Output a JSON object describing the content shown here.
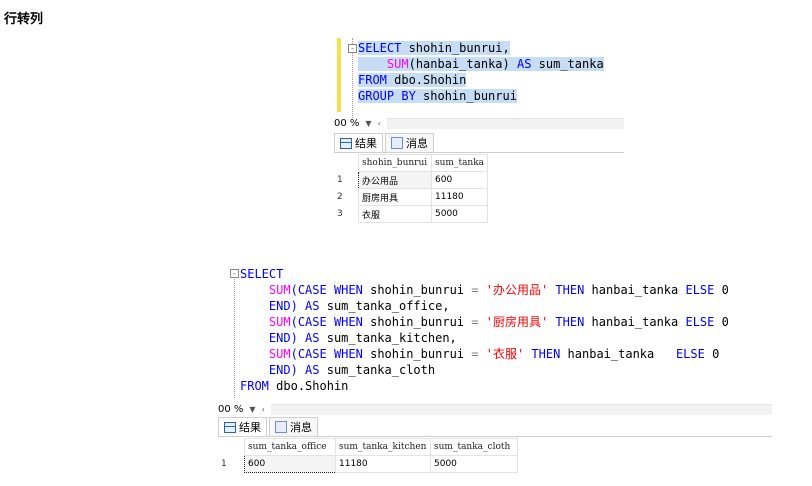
{
  "page": {
    "heading": "行转列"
  },
  "query1": {
    "lines": [
      [
        "SELECT",
        " shohin_bunrui,"
      ],
      [
        "SUM",
        "(hanbai_tanka) ",
        "AS",
        " sum_tanka"
      ],
      [
        "FROM",
        " dbo.Shohin"
      ],
      [
        "GROUP BY",
        " shohin_bunrui"
      ]
    ],
    "zoom": "00 %",
    "tabs": {
      "results": "结果",
      "messages": "消息"
    },
    "columns": [
      "shohin_bunrui",
      "sum_tanka"
    ],
    "rows": [
      {
        "n": "1",
        "cat": "办公用品",
        "sum": "600"
      },
      {
        "n": "2",
        "cat": "厨房用具",
        "sum": "11180"
      },
      {
        "n": "3",
        "cat": "衣服",
        "sum": "5000"
      }
    ]
  },
  "query2": {
    "l1": "SELECT",
    "sum_kw": "SUM",
    "case_kw": "(CASE",
    "when_kw": "WHEN",
    "col": "shohin_bunrui",
    "eq": "=",
    "then_kw": "THEN",
    "tanka": "hanbai_tanka",
    "else_kw": "ELSE",
    "zero": "0",
    "end_kw": "END)",
    "as_kw": "AS",
    "s1": "'办公用品'",
    "a1": "sum_tanka_office,",
    "s2": "'厨房用具'",
    "a2": "sum_tanka_kitchen,",
    "s3": "'衣服'",
    "a3": "sum_tanka_cloth",
    "from_kw": "FROM",
    "from_tbl": "dbo.Shohin",
    "zoom": "00 %",
    "tabs": {
      "results": "结果",
      "messages": "消息"
    },
    "columns": [
      "sum_tanka_office",
      "sum_tanka_kitchen",
      "sum_tanka_cloth"
    ],
    "row": {
      "n": "1",
      "c1": "600",
      "c2": "11180",
      "c3": "5000"
    }
  },
  "colors": {
    "keyword": "#0000ff",
    "function": "#ff00ff",
    "string": "#ff0000",
    "selection": "#c7ddf5"
  },
  "icons": {
    "fold": "fold-minus-icon",
    "results": "grid-icon",
    "messages": "messages-icon"
  }
}
